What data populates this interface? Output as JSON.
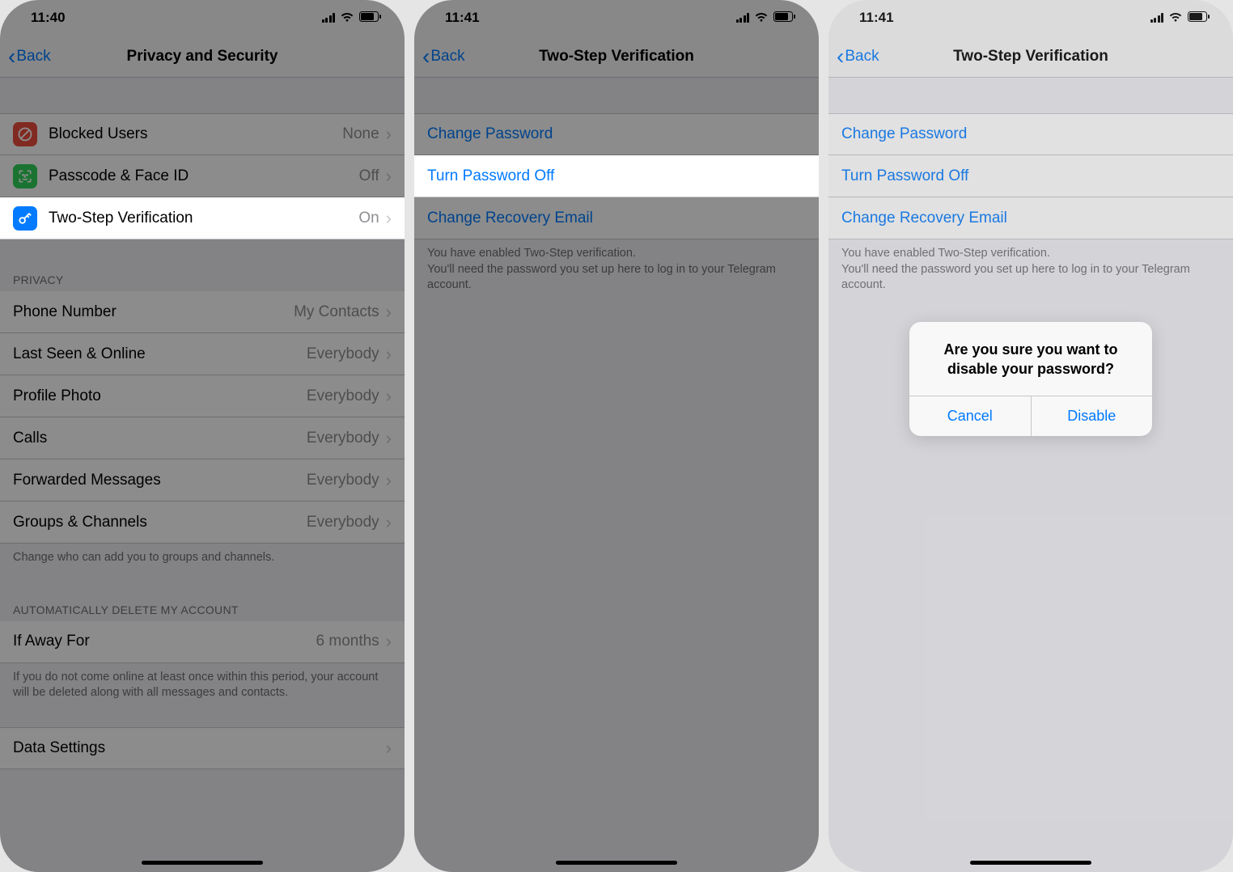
{
  "colors": {
    "link": "#007aff",
    "red_icon": "#eb4d3d",
    "green_icon": "#30d158",
    "blue_icon": "#027bff"
  },
  "screen1": {
    "time": "11:40",
    "back": "Back",
    "title": "Privacy and Security",
    "security_rows": [
      {
        "label": "Blocked Users",
        "value": "None",
        "icon_color": "#eb4d3d",
        "icon": "blocked"
      },
      {
        "label": "Passcode & Face ID",
        "value": "Off",
        "icon_color": "#30d158",
        "icon": "faceid"
      },
      {
        "label": "Two-Step Verification",
        "value": "On",
        "icon_color": "#027bff",
        "icon": "key"
      }
    ],
    "privacy_header": "PRIVACY",
    "privacy_rows": [
      {
        "label": "Phone Number",
        "value": "My Contacts"
      },
      {
        "label": "Last Seen & Online",
        "value": "Everybody"
      },
      {
        "label": "Profile Photo",
        "value": "Everybody"
      },
      {
        "label": "Calls",
        "value": "Everybody"
      },
      {
        "label": "Forwarded Messages",
        "value": "Everybody"
      },
      {
        "label": "Groups & Channels",
        "value": "Everybody"
      }
    ],
    "privacy_footer": "Change who can add you to groups and channels.",
    "delete_header": "AUTOMATICALLY DELETE MY ACCOUNT",
    "delete_row": {
      "label": "If Away For",
      "value": "6 months"
    },
    "delete_footer": "If you do not come online at least once within this period, your account will be deleted along with all messages and contacts.",
    "data_row": {
      "label": "Data Settings"
    }
  },
  "screen2": {
    "time": "11:41",
    "back": "Back",
    "title": "Two-Step Verification",
    "rows": [
      {
        "label": "Change Password"
      },
      {
        "label": "Turn Password Off"
      },
      {
        "label": "Change Recovery Email"
      }
    ],
    "footer": "You have enabled Two-Step verification.\nYou'll need the password you set up here to log in to your Telegram account."
  },
  "screen3": {
    "time": "11:41",
    "back": "Back",
    "title": "Two-Step Verification",
    "rows": [
      {
        "label": "Change Password"
      },
      {
        "label": "Turn Password Off"
      },
      {
        "label": "Change Recovery Email"
      }
    ],
    "footer": "You have enabled Two-Step verification.\nYou'll need the password you set up here to log in to your Telegram account.",
    "alert": {
      "message": "Are you sure you want to disable your password?",
      "cancel": "Cancel",
      "confirm": "Disable"
    }
  }
}
